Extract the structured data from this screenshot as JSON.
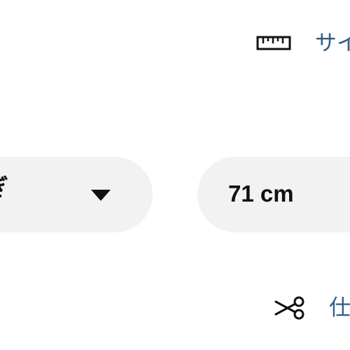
{
  "size_guide": {
    "icon": "ruler-icon",
    "label": "サイ"
  },
  "length_select": {
    "visible_text": "ぎ",
    "icon": "caret-down-icon"
  },
  "measurement": {
    "value": "71 cm"
  },
  "tailoring": {
    "icon": "scissors-icon",
    "label": "仕"
  },
  "colors": {
    "link": "#2f5d86",
    "pill_background": "#f2f2f2",
    "text": "#111111"
  }
}
